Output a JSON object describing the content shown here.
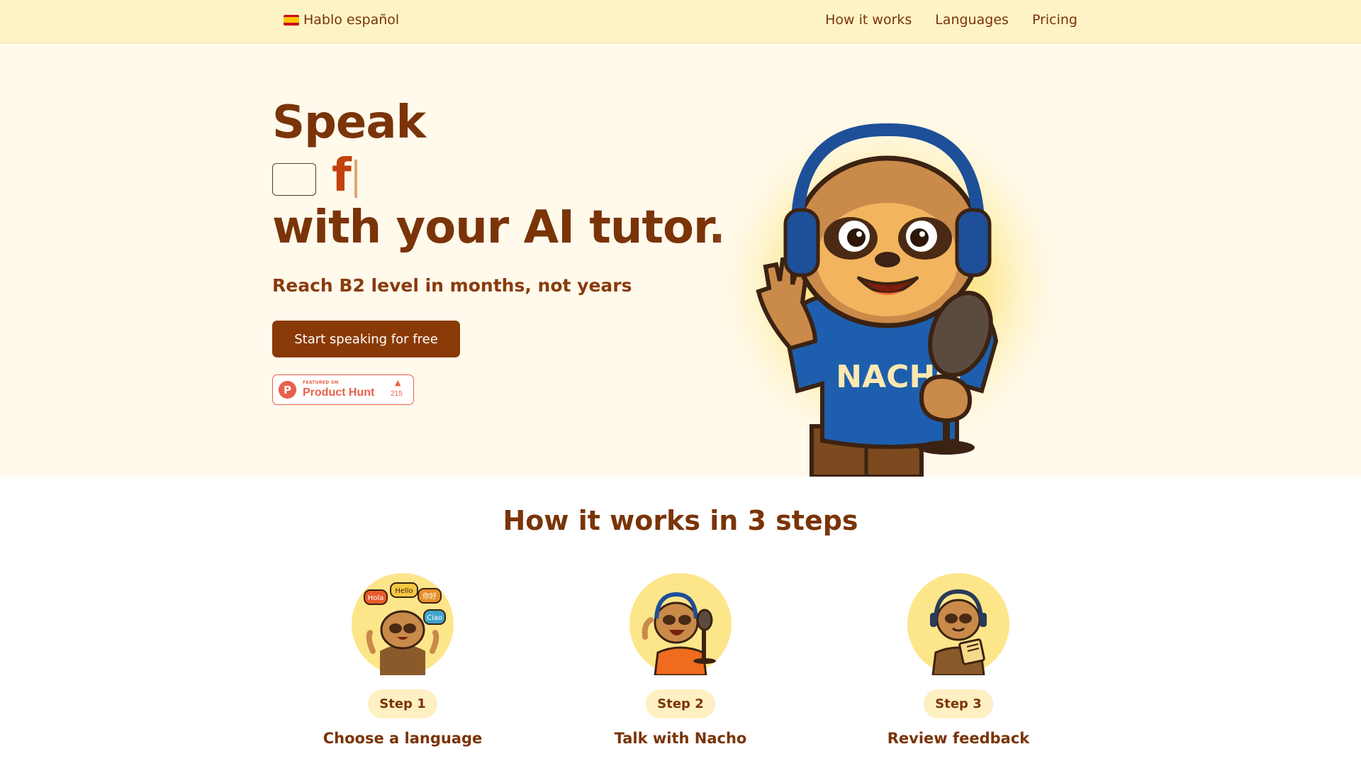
{
  "nav": {
    "brand": "Hablo español",
    "links": [
      "How it works",
      "Languages",
      "Pricing"
    ]
  },
  "hero": {
    "line1": "Speak",
    "typed": "f",
    "line3": "with your AI tutor.",
    "subtitle": "Reach B2 level in months, not years",
    "cta": "Start speaking for free",
    "mascot_shirt": "NACHO",
    "product_hunt": {
      "featured": "FEATURED ON",
      "name": "Product Hunt",
      "count": "215"
    }
  },
  "steps": {
    "title": "How it works in 3 steps",
    "items": [
      {
        "badge": "Step 1",
        "label": "Choose a language",
        "bubbles": [
          "Hola",
          "Hello",
          "你好",
          "Ciao"
        ]
      },
      {
        "badge": "Step 2",
        "label": "Talk with Nacho"
      },
      {
        "badge": "Step 3",
        "label": "Review feedback"
      }
    ]
  },
  "colors": {
    "brand_brown": "#7a3408",
    "cta": "#8a3a06",
    "accent_orange": "#c2410c",
    "topbar": "#fef3c7",
    "hero_bg": "#fffaeb",
    "product_hunt": "#e8604a"
  }
}
